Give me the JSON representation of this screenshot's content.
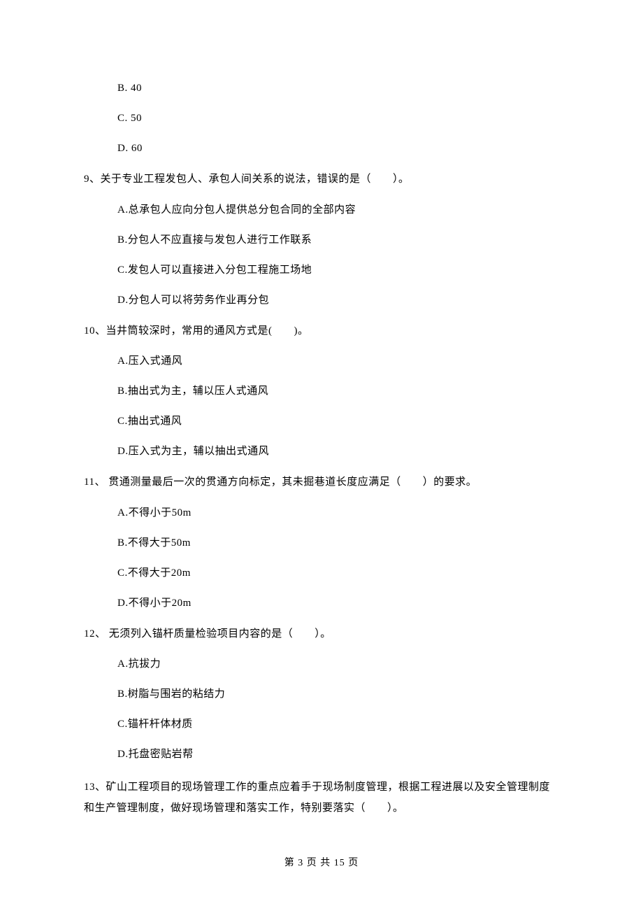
{
  "options_top": [
    "B. 40",
    "C. 50",
    "D. 60"
  ],
  "q9": {
    "stem": "9、关于专业工程发包人、承包人间关系的说法，错误的是（　　）。",
    "opts": [
      "A.总承包人应向分包人提供总分包合同的全部内容",
      "B.分包人不应直接与发包人进行工作联系",
      "C.发包人可以直接进入分包工程施工场地",
      "D.分包人可以将劳务作业再分包"
    ]
  },
  "q10": {
    "stem": "10、当井筒较深时，常用的通风方式是(　　)。",
    "opts": [
      "A.压入式通风",
      "B.抽出式为主，辅以压人式通风",
      "C.抽出式通风",
      "D.压入式为主，辅以抽出式通风"
    ]
  },
  "q11": {
    "stem": "11、 贯通测量最后一次的贯通方向标定，其未掘巷道长度应满足（　　）的要求。",
    "opts": [
      "A.不得小于50m",
      "B.不得大于50m",
      "C.不得大于20m",
      "D.不得小于20m"
    ]
  },
  "q12": {
    "stem": "12、 无须列入锚杆质量检验项目内容的是（　　）。",
    "opts": [
      "A.抗拔力",
      "B.树脂与围岩的粘结力",
      "C.锚杆杆体材质",
      "D.托盘密贴岩帮"
    ]
  },
  "q13": {
    "stem": "13、矿山工程项目的现场管理工作的重点应着手于现场制度管理，根据工程进展以及安全管理制度和生产管理制度，做好现场管理和落实工作，特别要落实（　　）。"
  },
  "footer": "第 3 页 共 15 页"
}
